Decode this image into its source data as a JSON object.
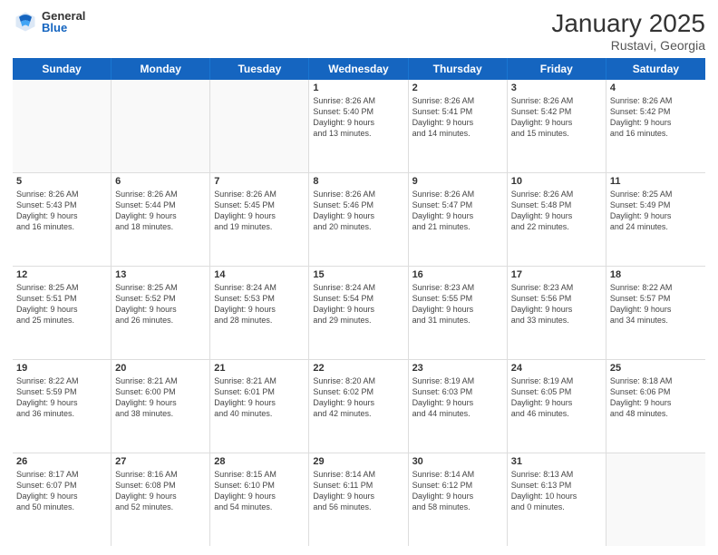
{
  "header": {
    "logo_general": "General",
    "logo_blue": "Blue",
    "month_title": "January 2025",
    "location": "Rustavi, Georgia"
  },
  "days_of_week": [
    "Sunday",
    "Monday",
    "Tuesday",
    "Wednesday",
    "Thursday",
    "Friday",
    "Saturday"
  ],
  "weeks": [
    [
      {
        "day": "",
        "info": ""
      },
      {
        "day": "",
        "info": ""
      },
      {
        "day": "",
        "info": ""
      },
      {
        "day": "1",
        "info": "Sunrise: 8:26 AM\nSunset: 5:40 PM\nDaylight: 9 hours\nand 13 minutes."
      },
      {
        "day": "2",
        "info": "Sunrise: 8:26 AM\nSunset: 5:41 PM\nDaylight: 9 hours\nand 14 minutes."
      },
      {
        "day": "3",
        "info": "Sunrise: 8:26 AM\nSunset: 5:42 PM\nDaylight: 9 hours\nand 15 minutes."
      },
      {
        "day": "4",
        "info": "Sunrise: 8:26 AM\nSunset: 5:42 PM\nDaylight: 9 hours\nand 16 minutes."
      }
    ],
    [
      {
        "day": "5",
        "info": "Sunrise: 8:26 AM\nSunset: 5:43 PM\nDaylight: 9 hours\nand 16 minutes."
      },
      {
        "day": "6",
        "info": "Sunrise: 8:26 AM\nSunset: 5:44 PM\nDaylight: 9 hours\nand 18 minutes."
      },
      {
        "day": "7",
        "info": "Sunrise: 8:26 AM\nSunset: 5:45 PM\nDaylight: 9 hours\nand 19 minutes."
      },
      {
        "day": "8",
        "info": "Sunrise: 8:26 AM\nSunset: 5:46 PM\nDaylight: 9 hours\nand 20 minutes."
      },
      {
        "day": "9",
        "info": "Sunrise: 8:26 AM\nSunset: 5:47 PM\nDaylight: 9 hours\nand 21 minutes."
      },
      {
        "day": "10",
        "info": "Sunrise: 8:26 AM\nSunset: 5:48 PM\nDaylight: 9 hours\nand 22 minutes."
      },
      {
        "day": "11",
        "info": "Sunrise: 8:25 AM\nSunset: 5:49 PM\nDaylight: 9 hours\nand 24 minutes."
      }
    ],
    [
      {
        "day": "12",
        "info": "Sunrise: 8:25 AM\nSunset: 5:51 PM\nDaylight: 9 hours\nand 25 minutes."
      },
      {
        "day": "13",
        "info": "Sunrise: 8:25 AM\nSunset: 5:52 PM\nDaylight: 9 hours\nand 26 minutes."
      },
      {
        "day": "14",
        "info": "Sunrise: 8:24 AM\nSunset: 5:53 PM\nDaylight: 9 hours\nand 28 minutes."
      },
      {
        "day": "15",
        "info": "Sunrise: 8:24 AM\nSunset: 5:54 PM\nDaylight: 9 hours\nand 29 minutes."
      },
      {
        "day": "16",
        "info": "Sunrise: 8:23 AM\nSunset: 5:55 PM\nDaylight: 9 hours\nand 31 minutes."
      },
      {
        "day": "17",
        "info": "Sunrise: 8:23 AM\nSunset: 5:56 PM\nDaylight: 9 hours\nand 33 minutes."
      },
      {
        "day": "18",
        "info": "Sunrise: 8:22 AM\nSunset: 5:57 PM\nDaylight: 9 hours\nand 34 minutes."
      }
    ],
    [
      {
        "day": "19",
        "info": "Sunrise: 8:22 AM\nSunset: 5:59 PM\nDaylight: 9 hours\nand 36 minutes."
      },
      {
        "day": "20",
        "info": "Sunrise: 8:21 AM\nSunset: 6:00 PM\nDaylight: 9 hours\nand 38 minutes."
      },
      {
        "day": "21",
        "info": "Sunrise: 8:21 AM\nSunset: 6:01 PM\nDaylight: 9 hours\nand 40 minutes."
      },
      {
        "day": "22",
        "info": "Sunrise: 8:20 AM\nSunset: 6:02 PM\nDaylight: 9 hours\nand 42 minutes."
      },
      {
        "day": "23",
        "info": "Sunrise: 8:19 AM\nSunset: 6:03 PM\nDaylight: 9 hours\nand 44 minutes."
      },
      {
        "day": "24",
        "info": "Sunrise: 8:19 AM\nSunset: 6:05 PM\nDaylight: 9 hours\nand 46 minutes."
      },
      {
        "day": "25",
        "info": "Sunrise: 8:18 AM\nSunset: 6:06 PM\nDaylight: 9 hours\nand 48 minutes."
      }
    ],
    [
      {
        "day": "26",
        "info": "Sunrise: 8:17 AM\nSunset: 6:07 PM\nDaylight: 9 hours\nand 50 minutes."
      },
      {
        "day": "27",
        "info": "Sunrise: 8:16 AM\nSunset: 6:08 PM\nDaylight: 9 hours\nand 52 minutes."
      },
      {
        "day": "28",
        "info": "Sunrise: 8:15 AM\nSunset: 6:10 PM\nDaylight: 9 hours\nand 54 minutes."
      },
      {
        "day": "29",
        "info": "Sunrise: 8:14 AM\nSunset: 6:11 PM\nDaylight: 9 hours\nand 56 minutes."
      },
      {
        "day": "30",
        "info": "Sunrise: 8:14 AM\nSunset: 6:12 PM\nDaylight: 9 hours\nand 58 minutes."
      },
      {
        "day": "31",
        "info": "Sunrise: 8:13 AM\nSunset: 6:13 PM\nDaylight: 10 hours\nand 0 minutes."
      },
      {
        "day": "",
        "info": ""
      }
    ]
  ]
}
